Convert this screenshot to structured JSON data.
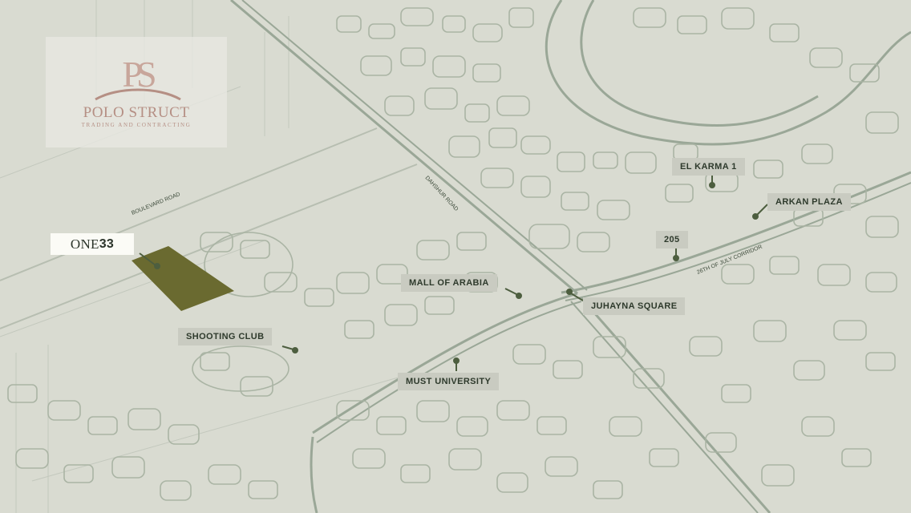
{
  "logo": {
    "monogram": "PS",
    "name": "POLO STRUCT",
    "tagline": "TRADING AND CONTRACTING"
  },
  "project": {
    "name_prefix": "ONE",
    "name_number": "33"
  },
  "landmarks": [
    {
      "id": "el-karma-1",
      "label": "EL KARMA 1"
    },
    {
      "id": "arkan-plaza",
      "label": "ARKAN PLAZA"
    },
    {
      "id": "205",
      "label": "205"
    },
    {
      "id": "mall-of-arabia",
      "label": "MALL OF ARABIA"
    },
    {
      "id": "juhayna-square",
      "label": "JUHAYNA SQUARE"
    },
    {
      "id": "shooting-club",
      "label": "SHOOTING CLUB"
    },
    {
      "id": "must-university",
      "label": "MUST UNIVERSITY"
    }
  ],
  "roads": {
    "boulevard": "BOULEVARD ROAD",
    "dahshur": "DAHSHUR ROAD",
    "corridor": "26TH OF JULY CORRIDOR"
  },
  "colors": {
    "background": "#d9dbd1",
    "road": "#a9b3a3",
    "major_road": "#9aa797",
    "plot": "#6a6a30",
    "label_bg": "#c9cbc1",
    "label_text": "#2e3a2c",
    "logo_accent": "#b58f84"
  }
}
